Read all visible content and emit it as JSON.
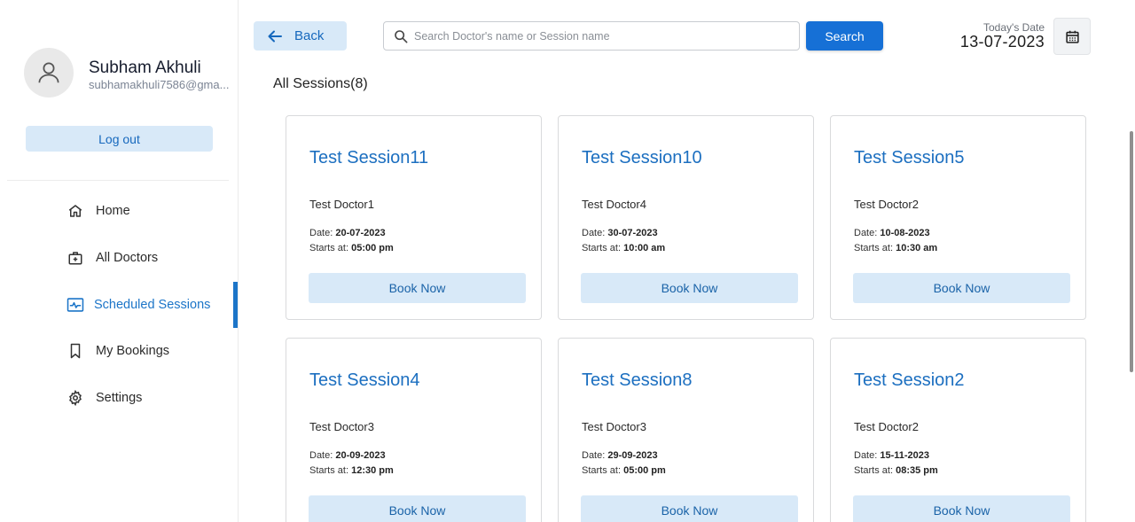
{
  "user": {
    "name": "Subham Akhuli",
    "email": "subhamakhuli7586@gma..."
  },
  "sidebar": {
    "logout_label": "Log out",
    "items": [
      {
        "label": "Home",
        "icon": "home-icon",
        "active": false
      },
      {
        "label": "All Doctors",
        "icon": "doctor-bag-icon",
        "active": false
      },
      {
        "label": "Scheduled Sessions",
        "icon": "sessions-icon",
        "active": true
      },
      {
        "label": "My Bookings",
        "icon": "bookmark-icon",
        "active": false
      },
      {
        "label": "Settings",
        "icon": "gear-icon",
        "active": false
      }
    ]
  },
  "topbar": {
    "back_label": "Back",
    "search_placeholder": "Search Doctor's name or Session name",
    "search_label": "Search",
    "date_caption": "Today's Date",
    "date_value": "13-07-2023"
  },
  "main": {
    "section_title": "All Sessions(8)",
    "date_prefix": "Date: ",
    "time_prefix": "Starts at: ",
    "book_label": "Book Now",
    "sessions": [
      {
        "title": "Test Session11",
        "doctor": "Test Doctor1",
        "date": "20-07-2023",
        "time": "05:00 pm"
      },
      {
        "title": "Test Session10",
        "doctor": "Test Doctor4",
        "date": "30-07-2023",
        "time": "10:00 am"
      },
      {
        "title": "Test Session5",
        "doctor": "Test Doctor2",
        "date": "10-08-2023",
        "time": "10:30 am"
      },
      {
        "title": "Test Session4",
        "doctor": "Test Doctor3",
        "date": "20-09-2023",
        "time": "12:30 pm"
      },
      {
        "title": "Test Session8",
        "doctor": "Test Doctor3",
        "date": "29-09-2023",
        "time": "05:00 pm"
      },
      {
        "title": "Test Session2",
        "doctor": "Test Doctor2",
        "date": "15-11-2023",
        "time": "08:35 pm"
      }
    ]
  },
  "colors": {
    "accent": "#1c75c8",
    "button_light": "#d8e9f8",
    "primary_button": "#1670d6"
  }
}
